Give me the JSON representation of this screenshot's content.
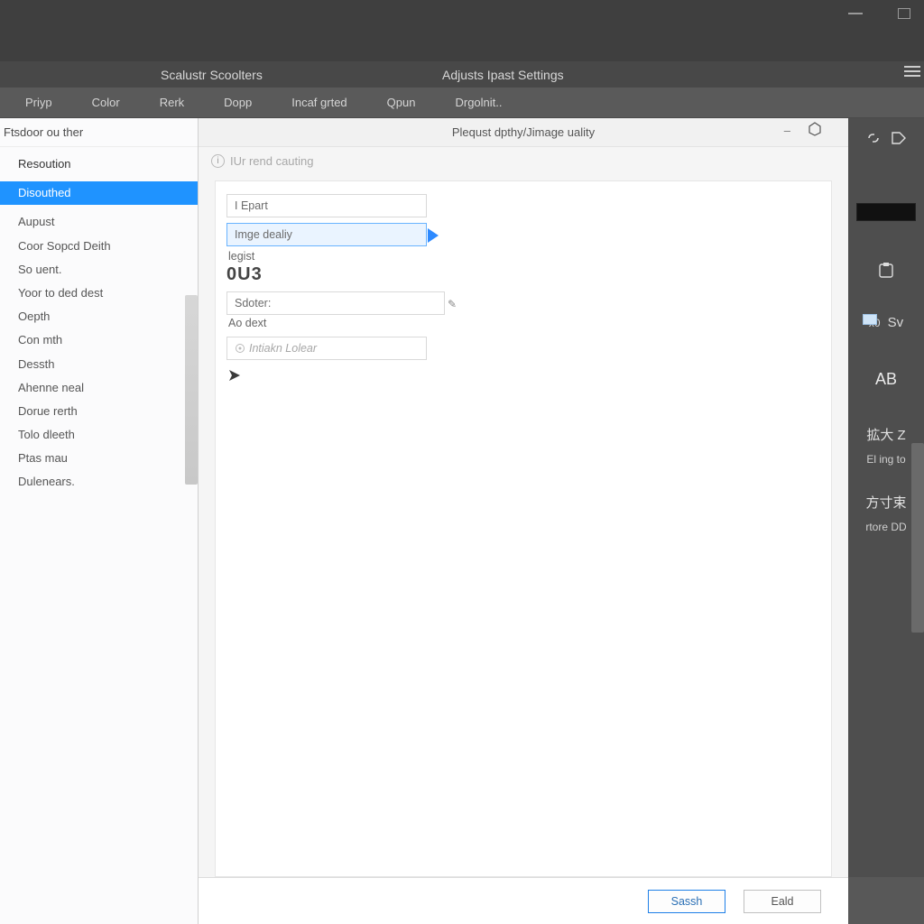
{
  "header": {
    "left_title": "Scalustr Scoolters",
    "center_title": "Adjusts Ipast Settings"
  },
  "toolbar": {
    "tabs": [
      "Priyp",
      "Color",
      "Rerk",
      "Dopp",
      "Incaf grted",
      "Qpun",
      "Drgolnit.."
    ]
  },
  "sidebar": {
    "header": "Ftsdoor ou ther",
    "items": [
      "Resoution",
      "Disouthed",
      "Aupust",
      "Coor Sopcd Deith",
      "So uent.",
      "Yoor to ded dest",
      "Oepth",
      "Con mth",
      "Dessth",
      "Ahenne neal",
      "Dorue rerth",
      "Tolo dleeth",
      "Ptas mau",
      "Dulenears."
    ],
    "selected_index": 1
  },
  "panel": {
    "title": "Plequst dpthy/Jimage uality",
    "minimize_symbol": "–",
    "subtitle": "IUr rend cauting",
    "fields": {
      "epart": "I Epart",
      "image_dealy": "Imge dealiy",
      "legist": "legist",
      "big_number": "0U3",
      "sdoter": "Sdoter:",
      "ao_dest": "Ao dext",
      "intekn": "Intiakn Lolear"
    }
  },
  "right_rail": {
    "item1_num": "x0",
    "item1_label": "Sv",
    "letters": "AB",
    "cjk1": "拡大 Z",
    "desc": "El ing to",
    "cjk2": "方寸束",
    "note": "rtore DD"
  },
  "buttons": {
    "save": "Sassh",
    "exit": "Eald"
  }
}
